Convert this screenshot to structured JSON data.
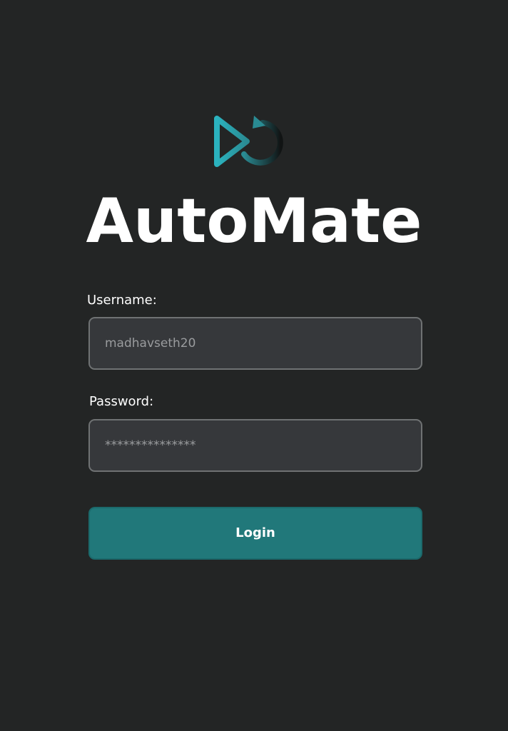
{
  "app": {
    "title": "AutoMate",
    "logo_icon": "automate-play-replay-logo",
    "brand_color": "#21787a"
  },
  "form": {
    "username_label": "Username:",
    "username_value": "madhavseth20",
    "password_label": "Password:",
    "password_value": "***************",
    "login_label": "Login"
  },
  "colors": {
    "background": "#232525",
    "input_background": "#36383b",
    "input_border": "#6f7273",
    "button": "#21787a"
  }
}
